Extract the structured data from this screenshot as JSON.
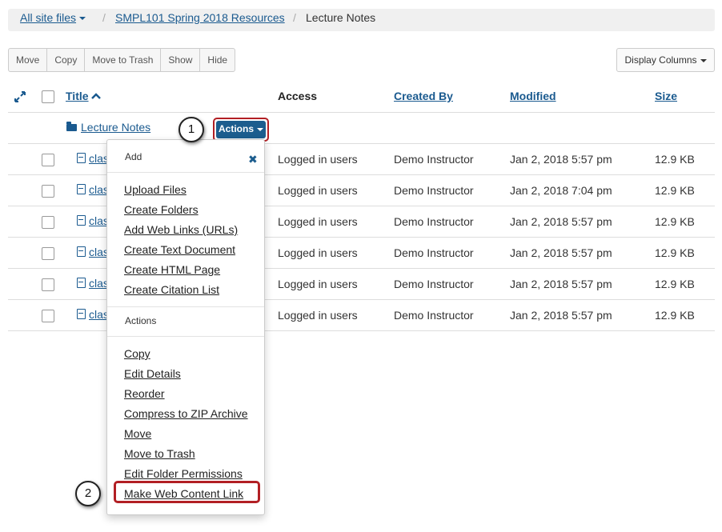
{
  "breadcrumb": {
    "root": "All site files",
    "site": "SMPL101 Spring 2018 Resources",
    "current": "Lecture Notes",
    "separator": "/"
  },
  "toolbar": {
    "move": "Move",
    "copy": "Copy",
    "move_to_trash": "Move to Trash",
    "show": "Show",
    "hide": "Hide",
    "display_columns": "Display Columns"
  },
  "table": {
    "headers": {
      "title": "Title",
      "access": "Access",
      "created_by": "Created By",
      "modified": "Modified",
      "size": "Size"
    },
    "folder": {
      "name": "Lecture Notes",
      "actions_label": "Actions"
    },
    "rows": [
      {
        "name": "clas",
        "access": "Logged in users",
        "created_by": "Demo Instructor",
        "modified": "Jan 2, 2018 5:57 pm",
        "size": "12.9 KB"
      },
      {
        "name": "clas",
        "access": "Logged in users",
        "created_by": "Demo Instructor",
        "modified": "Jan 2, 2018 7:04 pm",
        "size": "12.9 KB"
      },
      {
        "name": "clas",
        "access": "Logged in users",
        "created_by": "Demo Instructor",
        "modified": "Jan 2, 2018 5:57 pm",
        "size": "12.9 KB"
      },
      {
        "name": "clas",
        "access": "Logged in users",
        "created_by": "Demo Instructor",
        "modified": "Jan 2, 2018 5:57 pm",
        "size": "12.9 KB"
      },
      {
        "name": "clas",
        "access": "Logged in users",
        "created_by": "Demo Instructor",
        "modified": "Jan 2, 2018 5:57 pm",
        "size": "12.9 KB"
      },
      {
        "name": "clas",
        "access": "Logged in users",
        "created_by": "Demo Instructor",
        "modified": "Jan 2, 2018 5:57 pm",
        "size": "12.9 KB"
      }
    ]
  },
  "menu": {
    "add_header": "Add",
    "close_glyph": "✖",
    "add_items": [
      "Upload Files",
      "Create Folders",
      "Add Web Links (URLs)",
      "Create Text Document",
      "Create HTML Page",
      "Create Citation List"
    ],
    "actions_header": "Actions",
    "action_items": [
      "Copy",
      "Edit Details",
      "Reorder",
      "Compress to ZIP Archive",
      "Move",
      "Move to Trash",
      "Edit Folder Permissions",
      "Make Web Content Link"
    ]
  },
  "callouts": {
    "step1": "1",
    "step2": "2"
  },
  "colors": {
    "link": "#1a5a8f",
    "accent_button": "#1c5d8e",
    "highlight": "#b21f24"
  },
  "icons": {
    "expand": "expand-icon",
    "folder": "folder-open-icon",
    "file": "pdf-file-icon",
    "sort": "sort-ascending-icon",
    "close": "close-icon"
  }
}
